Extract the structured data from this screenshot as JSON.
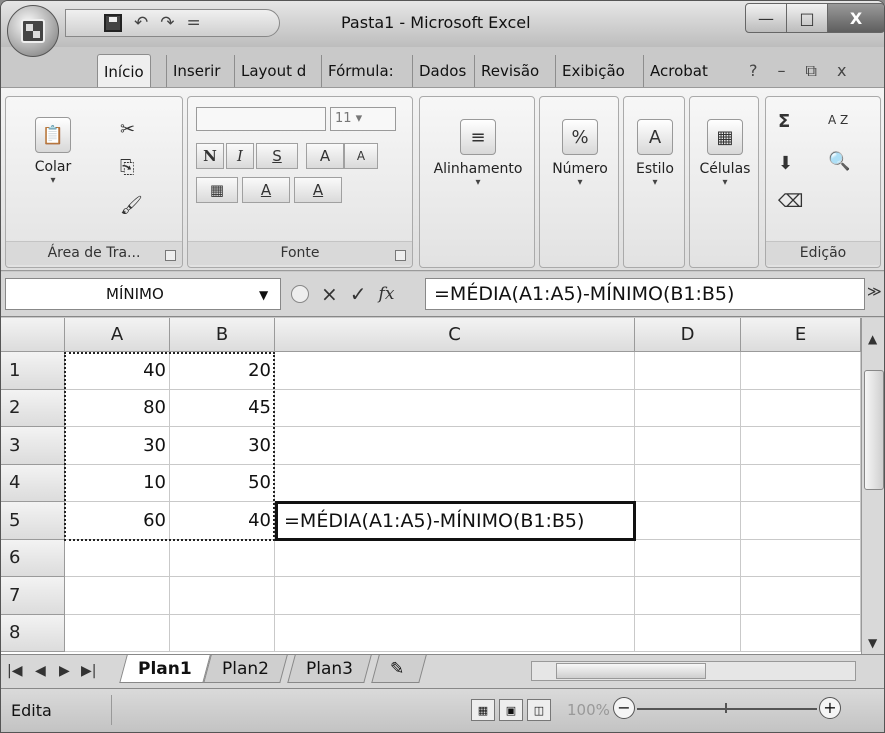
{
  "window": {
    "title": "Pasta1 - Microsoft Excel",
    "controls": {
      "minimize": "—",
      "maximize": "□",
      "close": "X"
    }
  },
  "quick_access": {
    "undo_icon": "↶",
    "redo_icon": "↷",
    "separator": "="
  },
  "ribbon_tabs": [
    "Início",
    "Inserir",
    "Layout d",
    "Fórmula:",
    "Dados",
    "Revisão",
    "Exibição",
    "Acrobat"
  ],
  "ribbon_tab_icons": {
    "help": "?",
    "minimize": "–",
    "restore": "⧉",
    "close": "x"
  },
  "ribbon": {
    "clipboard": {
      "paste_label": "Colar",
      "group_label": "Área de Tra..."
    },
    "font": {
      "font_name": "",
      "font_size": "11",
      "bold": "N",
      "italic": "I",
      "underline": "S",
      "grow": "A",
      "shrink": "A",
      "fill": "A",
      "color": "A",
      "group_label": "Fonte"
    },
    "alignment": {
      "label": "Alinhamento"
    },
    "number": {
      "label": "Número",
      "icon": "%"
    },
    "style": {
      "label": "Estilo"
    },
    "cells": {
      "label": "Células"
    },
    "editing": {
      "sum": "Σ",
      "sort": "A Z",
      "group_label": "Edição"
    }
  },
  "formula_bar": {
    "name_box": "MÍNIMO",
    "cancel": "×",
    "enter": "✓",
    "fx": "fx",
    "formula": "=MÉDIA(A1:A5)-MÍNIMO(B1:B5)",
    "expand": "≫"
  },
  "grid": {
    "columns": [
      "A",
      "B",
      "C",
      "D",
      "E"
    ],
    "rows": [
      "1",
      "2",
      "3",
      "4",
      "5",
      "6",
      "7",
      "8"
    ],
    "col_a": [
      "40",
      "80",
      "30",
      "10",
      "60",
      "",
      "",
      ""
    ],
    "col_b": [
      "20",
      "45",
      "30",
      "50",
      "40",
      "",
      "",
      ""
    ],
    "active_cell_text": "=MÉDIA(A1:A5)-MÍNIMO(B1:B5)"
  },
  "sheets": [
    "Plan1",
    "Plan2",
    "Plan3"
  ],
  "status": {
    "mode": "Edita",
    "zoom": "100%",
    "zoom_out": "−",
    "zoom_in": "+"
  }
}
